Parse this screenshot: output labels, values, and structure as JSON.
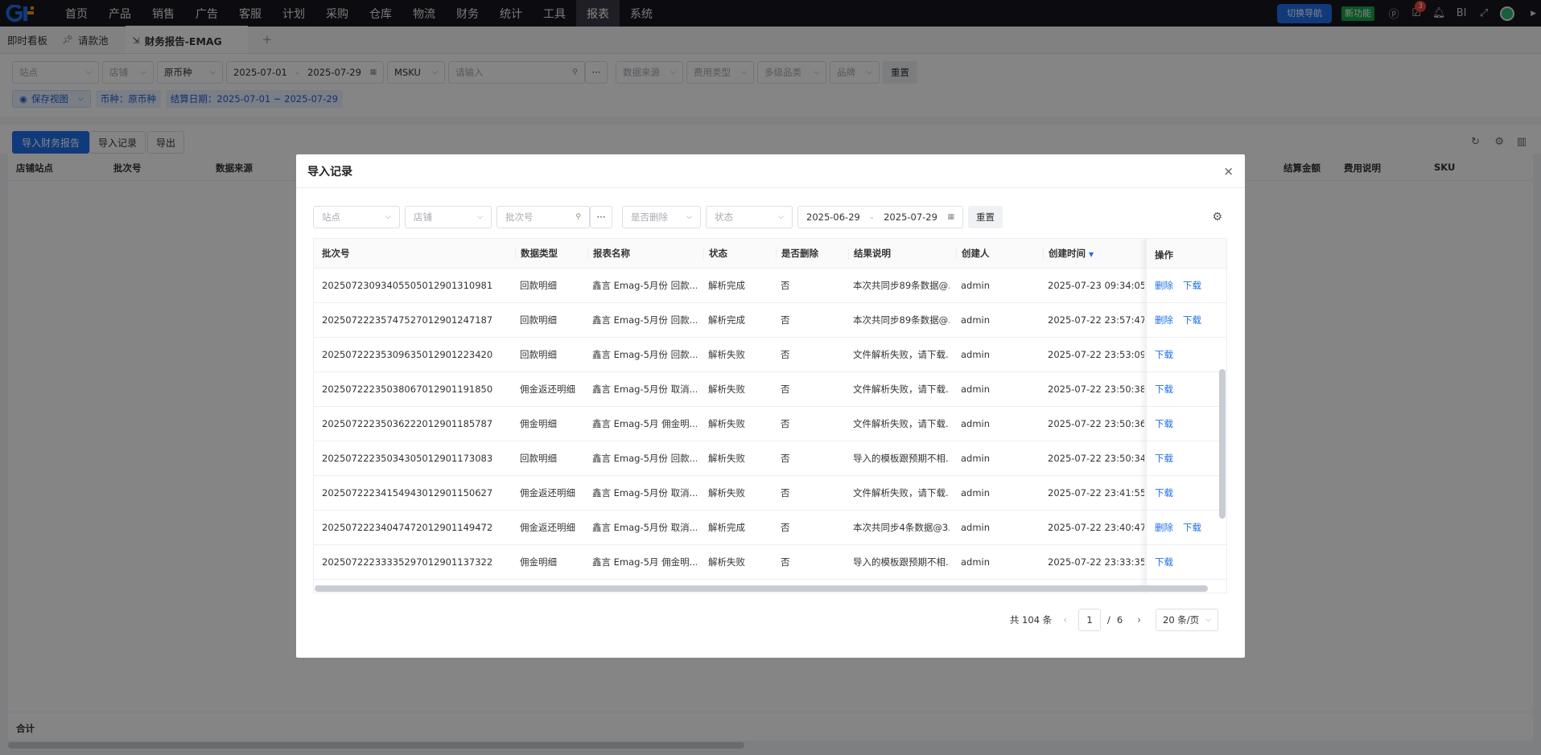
{
  "nav": {
    "menu": [
      "首页",
      "产品",
      "销售",
      "广告",
      "客服",
      "计划",
      "采购",
      "仓库",
      "物流",
      "财务",
      "统计",
      "工具",
      "报表",
      "系统"
    ],
    "active_index": 12,
    "switch_nav": "切换导航",
    "new_func": "新功能",
    "notification_count": "3",
    "bi_label": "BI"
  },
  "tabs": {
    "dashboard": "即时看板",
    "pool": "请款池",
    "active": "财务报告-EMAG"
  },
  "filters": {
    "site": "站点",
    "shop": "店铺",
    "currency": "原币种",
    "date_start": "2025-07-01",
    "date_sep": "-",
    "date_end": "2025-07-29",
    "msku": "MSKU",
    "search_placeholder": "请输入",
    "data_source": "数据来源",
    "fee_type": "费用类型",
    "category": "多级品类",
    "brand": "品牌",
    "reset": "重置",
    "save_view": "保存视图",
    "tag_currency": "币种：原币种",
    "tag_date": "结算日期：2025-07-01 ~ 2025-07-29"
  },
  "toolbar": {
    "import_report": "导入财务报告",
    "import_record": "导入记录",
    "export": "导出"
  },
  "bg_table": {
    "headers": [
      "店铺站点",
      "批次号",
      "数据来源",
      "结算金额",
      "费用说明",
      "SKU"
    ],
    "footer": "合计"
  },
  "modal": {
    "title": "导入记录",
    "filters": {
      "site": "站点",
      "shop": "店铺",
      "batch_placeholder": "批次号",
      "deleted": "是否删除",
      "status": "状态",
      "date_start": "2025-06-29",
      "date_sep": "-",
      "date_end": "2025-07-29",
      "reset": "重置"
    },
    "columns": [
      "批次号",
      "数据类型",
      "报表名称",
      "状态",
      "是否删除",
      "结果说明",
      "创建人",
      "创建时间",
      "操作"
    ],
    "rows": [
      {
        "batch": "202507230934055050129013109​81",
        "type": "回款明细",
        "report": "鑫言 Emag-5月份 回款...",
        "status": "解析完成",
        "deleted": "否",
        "result": "本次共同步89条数据@...",
        "creator": "admin",
        "time": "2025-07-23 09:34:05",
        "ops": [
          "删除",
          "下载"
        ]
      },
      {
        "batch": "20250722235747527012901247187",
        "type": "回款明细",
        "report": "鑫言 Emag-5月份 回款...",
        "status": "解析完成",
        "deleted": "否",
        "result": "本次共同步89条数据@...",
        "creator": "admin",
        "time": "2025-07-22 23:57:47",
        "ops": [
          "删除",
          "下载"
        ]
      },
      {
        "batch": "20250722235309635012901223420",
        "type": "回款明细",
        "report": "鑫言 Emag-5月份 回款...",
        "status": "解析失败",
        "deleted": "否",
        "result": "文件解析失败，请下载...",
        "creator": "admin",
        "time": "2025-07-22 23:53:09",
        "ops": [
          "下载"
        ]
      },
      {
        "batch": "20250722235038067012901191850",
        "type": "佣金返还明细",
        "report": "鑫言 Emag-5月份 取消...",
        "status": "解析失败",
        "deleted": "否",
        "result": "文件解析失败，请下载...",
        "creator": "admin",
        "time": "2025-07-22 23:50:38",
        "ops": [
          "下载"
        ]
      },
      {
        "batch": "20250722235036222012901185787",
        "type": "佣金明细",
        "report": "鑫言 Emag-5月 佣金明...",
        "status": "解析失败",
        "deleted": "否",
        "result": "文件解析失败，请下载...",
        "creator": "admin",
        "time": "2025-07-22 23:50:36",
        "ops": [
          "下载"
        ]
      },
      {
        "batch": "20250722235034305012901173083",
        "type": "回款明细",
        "report": "鑫言 Emag-5月份 回款...",
        "status": "解析失败",
        "deleted": "否",
        "result": "导入的模板跟预期不相...",
        "creator": "admin",
        "time": "2025-07-22 23:50:34",
        "ops": [
          "下载"
        ]
      },
      {
        "batch": "20250722234154943012901150627",
        "type": "佣金返还明细",
        "report": "鑫言 Emag-5月份 取消...",
        "status": "解析失败",
        "deleted": "否",
        "result": "文件解析失败，请下载...",
        "creator": "admin",
        "time": "2025-07-22 23:41:55",
        "ops": [
          "下载"
        ]
      },
      {
        "batch": "20250722234047472012901149472",
        "type": "佣金返还明细",
        "report": "鑫言 Emag-5月份 取消...",
        "status": "解析完成",
        "deleted": "否",
        "result": "本次共同步4条数据@3...",
        "creator": "admin",
        "time": "2025-07-22 23:40:47",
        "ops": [
          "删除",
          "下载"
        ]
      },
      {
        "batch": "20250722233335297012901137322",
        "type": "佣金明细",
        "report": "鑫言 Emag-5月 佣金明...",
        "status": "解析失败",
        "deleted": "否",
        "result": "导入的模板跟预期不相...",
        "creator": "admin",
        "time": "2025-07-22 23:33:35",
        "ops": [
          "下载"
        ]
      }
    ],
    "pager": {
      "total": "共 104 条",
      "current": "1",
      "sep": "/",
      "pages": "6",
      "size": "20 条/页"
    }
  },
  "colors": {
    "nav_bg": "#17171f",
    "accent": "#1f6feb",
    "new_func": "#16a34a"
  }
}
